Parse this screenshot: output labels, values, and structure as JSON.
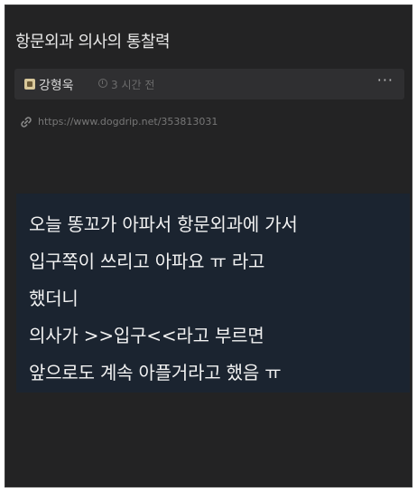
{
  "post": {
    "title": "항문외과 의사의 통찰력",
    "author": "강형욱",
    "time": "3 시간 전",
    "more_label": "···",
    "url": "https://www.dogdrip.net/353813031"
  },
  "content": {
    "lines": [
      "오늘 똥꼬가 아파서 항문외과에 가서",
      "입구쪽이 쓰리고 아파요 ㅠ 라고",
      "했더니",
      "의사가 >>입구<<라고 부르면",
      "앞으로도 계속 아플거라고 했음 ㅠ"
    ]
  },
  "icons": {
    "avatar": "avatar-icon",
    "clock": "clock-icon",
    "more": "more-icon",
    "link": "link-icon"
  },
  "colors": {
    "background": "#232324",
    "meta_bar": "#2f2f31",
    "content_box": "#1b2430",
    "text": "#f2f2f2",
    "muted": "#6c6c6c"
  }
}
